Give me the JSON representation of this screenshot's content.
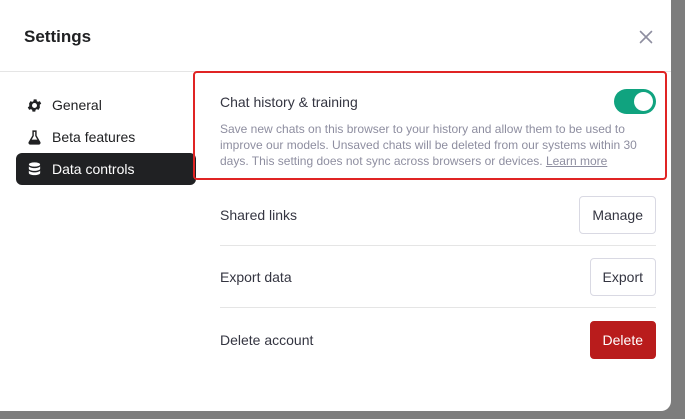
{
  "dialog": {
    "title": "Settings",
    "close_icon": "close-icon"
  },
  "sidebar": {
    "items": [
      {
        "label": "General",
        "icon": "gear-icon",
        "active": false
      },
      {
        "label": "Beta features",
        "icon": "flask-icon",
        "active": false
      },
      {
        "label": "Data controls",
        "icon": "database-icon",
        "active": true
      }
    ]
  },
  "chat_history": {
    "title": "Chat history & training",
    "enabled": true,
    "description": "Save new chats on this browser to your history and allow them to be used to improve our models. Unsaved chats will be deleted from our systems within 30 days. This setting does not sync across browsers or devices.",
    "learn_more": "Learn more"
  },
  "rows": {
    "shared_links": {
      "label": "Shared links",
      "button": "Manage"
    },
    "export_data": {
      "label": "Export data",
      "button": "Export"
    },
    "delete_account": {
      "label": "Delete account",
      "button": "Delete"
    }
  },
  "colors": {
    "toggle_on": "#10a37f",
    "danger": "#b91c1c",
    "highlight_border": "#e02424",
    "active_nav": "#202123"
  }
}
